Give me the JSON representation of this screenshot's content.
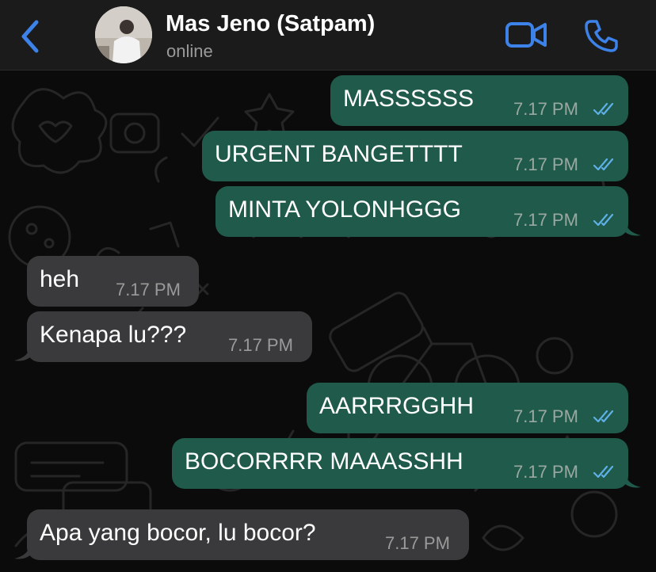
{
  "header": {
    "contact_name": "Mas Jeno (Satpam)",
    "status": "online"
  },
  "colors": {
    "accent": "#3d82e8",
    "outgoing_bubble": "#1f5a4a",
    "incoming_bubble": "#3a3a3c",
    "read_ticks": "#5fb0e8"
  },
  "icons": {
    "back": "chevron-left-icon",
    "video": "video-camera-icon",
    "call": "phone-icon",
    "read_status": "double-check-icon"
  },
  "messages": [
    {
      "direction": "out",
      "text": "MASSSSSS",
      "time": "7.17 PM",
      "read": true
    },
    {
      "direction": "out",
      "text": "URGENT BANGETTTT",
      "time": "7.17 PM",
      "read": true
    },
    {
      "direction": "out",
      "text": "MINTA YOLONHGGG",
      "time": "7.17 PM",
      "read": true
    },
    {
      "direction": "in",
      "text": "heh",
      "time": "7.17 PM"
    },
    {
      "direction": "in",
      "text": "Kenapa lu???",
      "time": "7.17 PM"
    },
    {
      "direction": "out",
      "text": "AARRRGGHH",
      "time": "7.17 PM",
      "read": true
    },
    {
      "direction": "out",
      "text": "BOCORRRR MAAASSHH",
      "time": "7.17 PM",
      "read": true
    },
    {
      "direction": "in",
      "text": "Apa yang bocor, lu bocor?",
      "time": "7.17 PM"
    }
  ]
}
